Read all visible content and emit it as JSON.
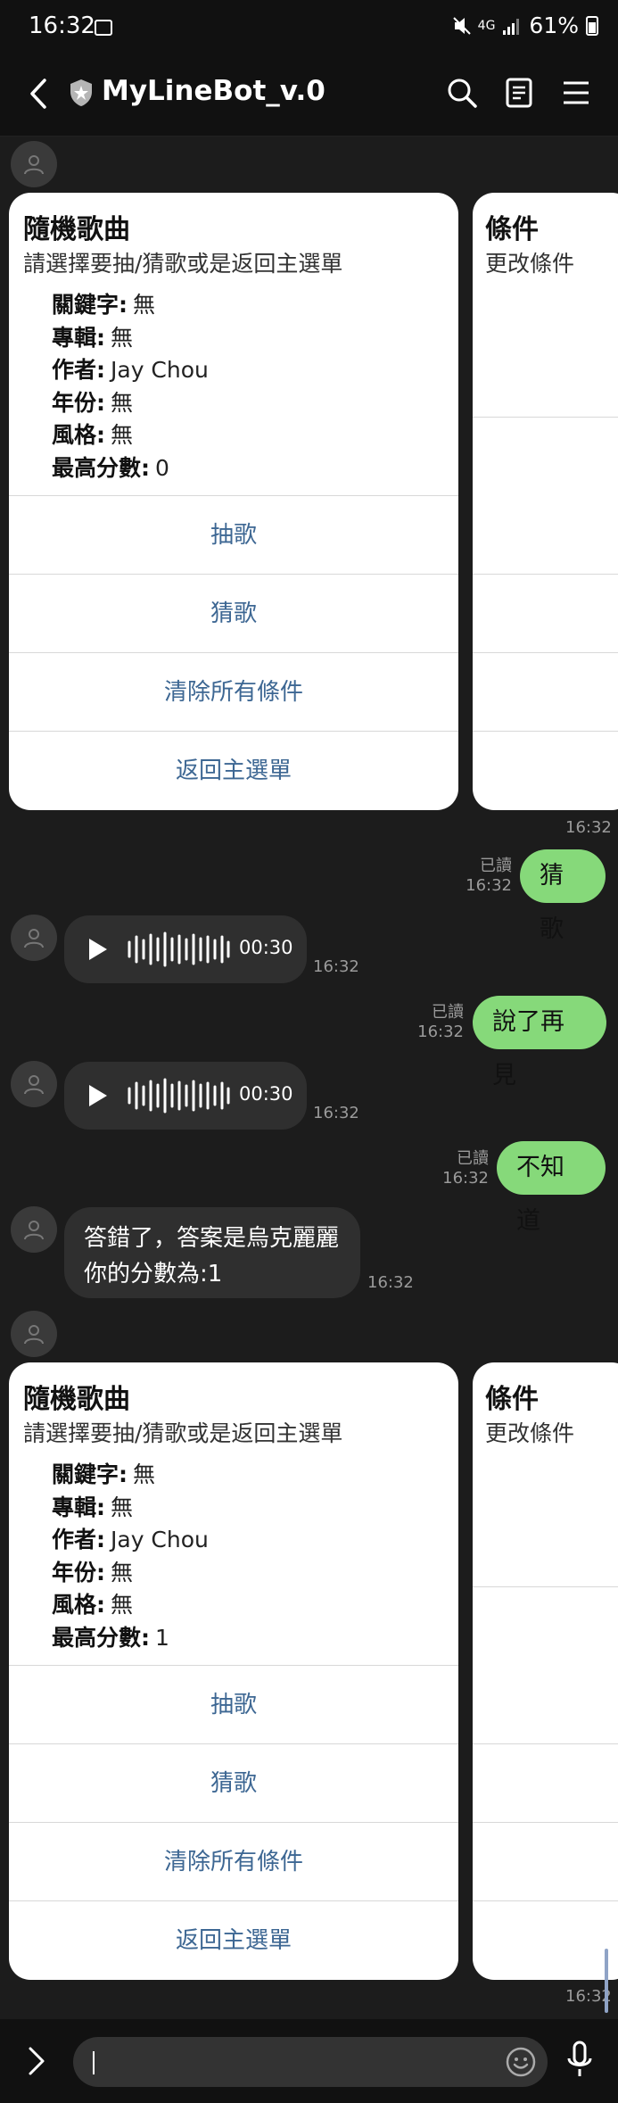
{
  "status_bar": {
    "time": "16:32",
    "signal_text": "4G",
    "battery": "61%"
  },
  "header": {
    "title": "MyLineBot_v.0"
  },
  "cards": [
    {
      "title": "隨機歌曲",
      "subtitle": "請選擇要抽/猜歌或是返回主選單",
      "info": [
        {
          "label": "關鍵字:",
          "value": "無"
        },
        {
          "label": "專輯:",
          "value": "無"
        },
        {
          "label": "作者:",
          "value": "Jay Chou"
        },
        {
          "label": "年份:",
          "value": "無"
        },
        {
          "label": "風格:",
          "value": "無"
        },
        {
          "label": "最高分數:",
          "value": "0"
        }
      ],
      "buttons": [
        "抽歌",
        "猜歌",
        "清除所有條件",
        "返回主選單"
      ],
      "side_title": "條件",
      "side_subtitle": "更改條件",
      "time": "16:32"
    },
    {
      "title": "隨機歌曲",
      "subtitle": "請選擇要抽/猜歌或是返回主選單",
      "info": [
        {
          "label": "關鍵字:",
          "value": "無"
        },
        {
          "label": "專輯:",
          "value": "無"
        },
        {
          "label": "作者:",
          "value": "Jay Chou"
        },
        {
          "label": "年份:",
          "value": "無"
        },
        {
          "label": "風格:",
          "value": "無"
        },
        {
          "label": "最高分數:",
          "value": "1"
        }
      ],
      "buttons": [
        "抽歌",
        "猜歌",
        "清除所有條件",
        "返回主選單"
      ],
      "side_title": "條件",
      "side_subtitle": "更改條件",
      "time": "16:32"
    }
  ],
  "messages": {
    "user1": {
      "text": "猜歌",
      "read": "已讀",
      "time": "16:32"
    },
    "audio1": {
      "duration": "00:30",
      "time": "16:32"
    },
    "user2": {
      "text": "說了再見",
      "read": "已讀",
      "time": "16:32"
    },
    "audio2": {
      "duration": "00:30",
      "time": "16:32"
    },
    "user3": {
      "text": "不知道",
      "read": "已讀",
      "time": "16:32"
    },
    "bot_text": {
      "line1": "答錯了，答案是烏克麗麗",
      "line2": "你的分數為:1",
      "time": "16:32"
    }
  },
  "colors": {
    "background": "#1c1c1c",
    "user_bubble": "#86d97a",
    "bot_bubble": "#2f2f2f",
    "card_button_text": "#3d6793"
  }
}
